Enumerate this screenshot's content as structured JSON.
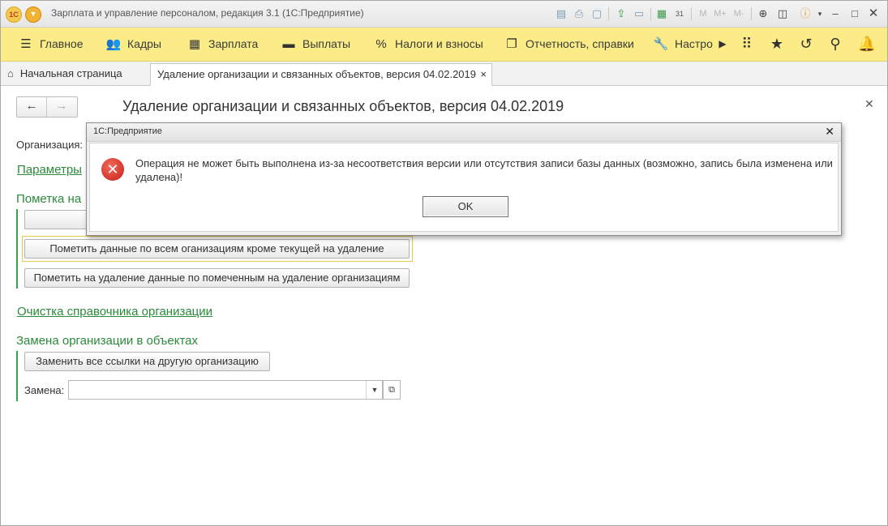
{
  "window": {
    "title": "Зарплата и управление персоналом, редакция 3.1  (1С:Предприятие)",
    "logo": "1С"
  },
  "toolbar_icons": [
    "save-icon",
    "print-icon",
    "preview-icon",
    "upload-icon",
    "download-icon",
    "calculator-icon",
    "calendar-icon",
    "m-icon",
    "m-plus-icon",
    "m-minus-icon",
    "zoom-icon",
    "panel-icon",
    "info-icon",
    "minimize-icon",
    "maximize-icon",
    "close-icon"
  ],
  "toolbar": {
    "m": "M",
    "m_plus": "M+",
    "m_minus": "M-",
    "calendar_day": "31"
  },
  "sections": [
    {
      "label": "Главное",
      "icon": "menu-lines-icon"
    },
    {
      "label": "Кадры",
      "icon": "people-icon"
    },
    {
      "label": "Зарплата",
      "icon": "calculator-icon"
    },
    {
      "label": "Выплаты",
      "icon": "wallet-icon"
    },
    {
      "label": "Налоги и взносы",
      "icon": "percent-icon"
    },
    {
      "label": "Отчетность, справки",
      "icon": "documents-icon"
    },
    {
      "label": "Настро",
      "icon": "wrench-icon"
    }
  ],
  "tabs": {
    "home": "Начальная страница",
    "active": "Удаление организации и связанных объектов, версия 04.02.2019",
    "close": "×"
  },
  "form": {
    "title": "Удаление организации и связанных объектов, версия 04.02.2019",
    "organization_label": "Организация:",
    "params_link": "Параметры",
    "mark_group": "Пометка на",
    "btn_mark_all_except": "Пометить данные по всем оганизациям кроме текущей на удаление",
    "btn_mark_by_marked": "Пометить на удаление данные по помеченным на удаление организациям",
    "cleanup_link": "Очистка справочника организации",
    "replace_group": "Замена организации в объектах",
    "btn_replace_all": "Заменить все ссылки на другую организацию",
    "replace_label": "Замена:",
    "replace_value": ""
  },
  "modal": {
    "title": "1С:Предприятие",
    "message": "Операция не может быть выполнена из-за несоответствия версии или отсутствия записи базы данных (возможно, запись была изменена или удалена)!",
    "ok": "OK"
  }
}
